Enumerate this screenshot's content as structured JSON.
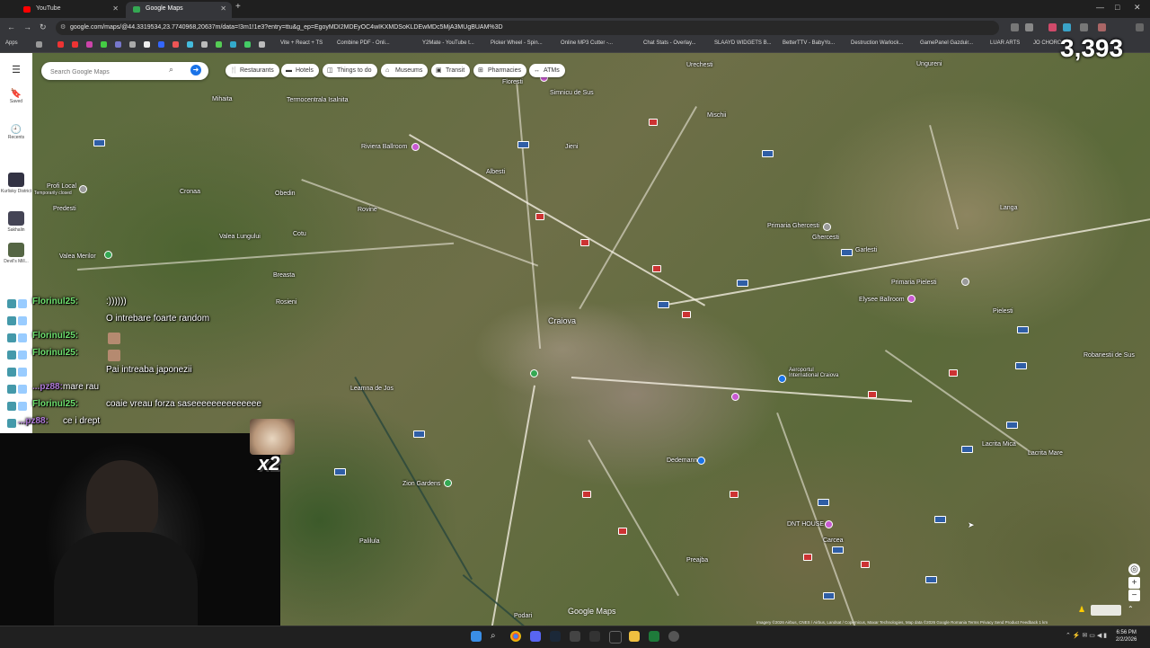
{
  "browser": {
    "tabs": [
      {
        "title": "YouTube",
        "icon": "youtube-icon",
        "color": "#ff0000"
      },
      {
        "title": "Google Maps",
        "icon": "google-maps-icon",
        "color": "#34a853"
      }
    ],
    "address": "google.com/maps/@44.3319534,23.7740968,20637m/data=!3m1!1e3?entry=ttu&g_ep=EgoyMDI2MDEyOC4wIKXMDSoKLDEwMDc5MjA3MUgBUAM%3D",
    "bookmarks": [
      "Apps",
      "Vite + React + TS",
      "Combine PDF - Onli...",
      "Y2Mate - YouTube t...",
      "Picker Wheel - Spin...",
      "Online MP3 Cutter -...",
      "Chat Stats - Overlay...",
      "SLAAYD WIDGETS B...",
      "BetterTTV - BabyYo...",
      "Destruction Warlock...",
      "GamePanel Gazduir...",
      "LUAR ARTS",
      "JO CHORO"
    ]
  },
  "maps": {
    "search_placeholder": "Search Google Maps",
    "chips": [
      "Restaurants",
      "Hotels",
      "Things to do",
      "Museums",
      "Transit",
      "Pharmacies",
      "ATMs"
    ],
    "rail": {
      "saved": "Saved",
      "recents": "Recents",
      "items": [
        "Kurlisky District",
        "Sakhalin",
        "Devil's Mill..."
      ]
    },
    "places": [
      {
        "label": "Urechesti",
        "cls": ""
      },
      {
        "label": "Ungureni",
        "cls": ""
      },
      {
        "label": "Mihaita",
        "cls": ""
      },
      {
        "label": "Termocentrala Isalnita",
        "cls": ""
      },
      {
        "label": "Floresti",
        "cls": ""
      },
      {
        "label": "Simnicu de Sus",
        "cls": ""
      },
      {
        "label": "Mischii",
        "cls": ""
      },
      {
        "label": "Riviera Ballroom",
        "cls": ""
      },
      {
        "label": "Jieni",
        "cls": ""
      },
      {
        "label": "Albesti",
        "cls": ""
      },
      {
        "label": "Profi Local",
        "cls": ""
      },
      {
        "label": "Temporarily closed",
        "cls": ""
      },
      {
        "label": "Predesti",
        "cls": ""
      },
      {
        "label": "Cronaa",
        "cls": ""
      },
      {
        "label": "Obedin",
        "cls": ""
      },
      {
        "label": "Rovine",
        "cls": ""
      },
      {
        "label": "Langa",
        "cls": ""
      },
      {
        "label": "Primaria Ghercesti",
        "cls": ""
      },
      {
        "label": "Ghercesti",
        "cls": ""
      },
      {
        "label": "Garlesti",
        "cls": ""
      },
      {
        "label": "Valea Lungului",
        "cls": ""
      },
      {
        "label": "Cotu",
        "cls": ""
      },
      {
        "label": "Valea Merilor",
        "cls": ""
      },
      {
        "label": "Breasta",
        "cls": ""
      },
      {
        "label": "Primaria Pielesti",
        "cls": ""
      },
      {
        "label": "Elysee Ballroom",
        "cls": ""
      },
      {
        "label": "Rosieni",
        "cls": ""
      },
      {
        "label": "Pielesti",
        "cls": ""
      },
      {
        "label": "Craiova",
        "cls": "city"
      },
      {
        "label": "Aeroportul International Craiova",
        "cls": ""
      },
      {
        "label": "Robanestii de Sus",
        "cls": ""
      },
      {
        "label": "Leamna de Jos",
        "cls": ""
      },
      {
        "label": "Lacrita Mica",
        "cls": ""
      },
      {
        "label": "Lacrita Mare",
        "cls": ""
      },
      {
        "label": "Dedemann",
        "cls": ""
      },
      {
        "label": "Zion Gardens",
        "cls": ""
      },
      {
        "label": "DNT HOUSE",
        "cls": ""
      },
      {
        "label": "Carcea",
        "cls": ""
      },
      {
        "label": "Palilula",
        "cls": ""
      },
      {
        "label": "Preajba",
        "cls": ""
      },
      {
        "label": "Podari",
        "cls": ""
      }
    ],
    "logo": "Google Maps",
    "attribution": "Imagery ©2026 Airbus, CNES / Airbus, Landsat / Copernicus, Maxar Technologies, Map data ©2026 Google   Romania   Terms   Privacy   Send Product Feedback   1 km"
  },
  "stream": {
    "counter": "3,393",
    "multiplier": "x2",
    "chat": [
      {
        "name": "Florinul25:",
        "msg": ":))))))",
        "color": "#6ee06e"
      },
      {
        "name": "",
        "msg": "O intrebare foarte random",
        "color": "#e03030"
      },
      {
        "name": "Florinul25:",
        "msg": "",
        "color": "#6ee06e"
      },
      {
        "name": "Florinul25:",
        "msg": "",
        "color": "#6ee06e"
      },
      {
        "name": "",
        "msg": "Pai intreaba japonezii",
        "color": "#e03030"
      },
      {
        "name": "...pz88:",
        "msg": "mare rau",
        "color": "#b07ad8"
      },
      {
        "name": "Florinul25:",
        "msg": "coaie vreau forza saseeeeeeeeeeeeee",
        "color": "#6ee06e"
      },
      {
        "name": "...pz88:",
        "msg": "ce i drept",
        "color": "#b07ad8"
      }
    ]
  },
  "taskbar": {
    "time": "6:56 PM",
    "date": "2/2/2026"
  }
}
